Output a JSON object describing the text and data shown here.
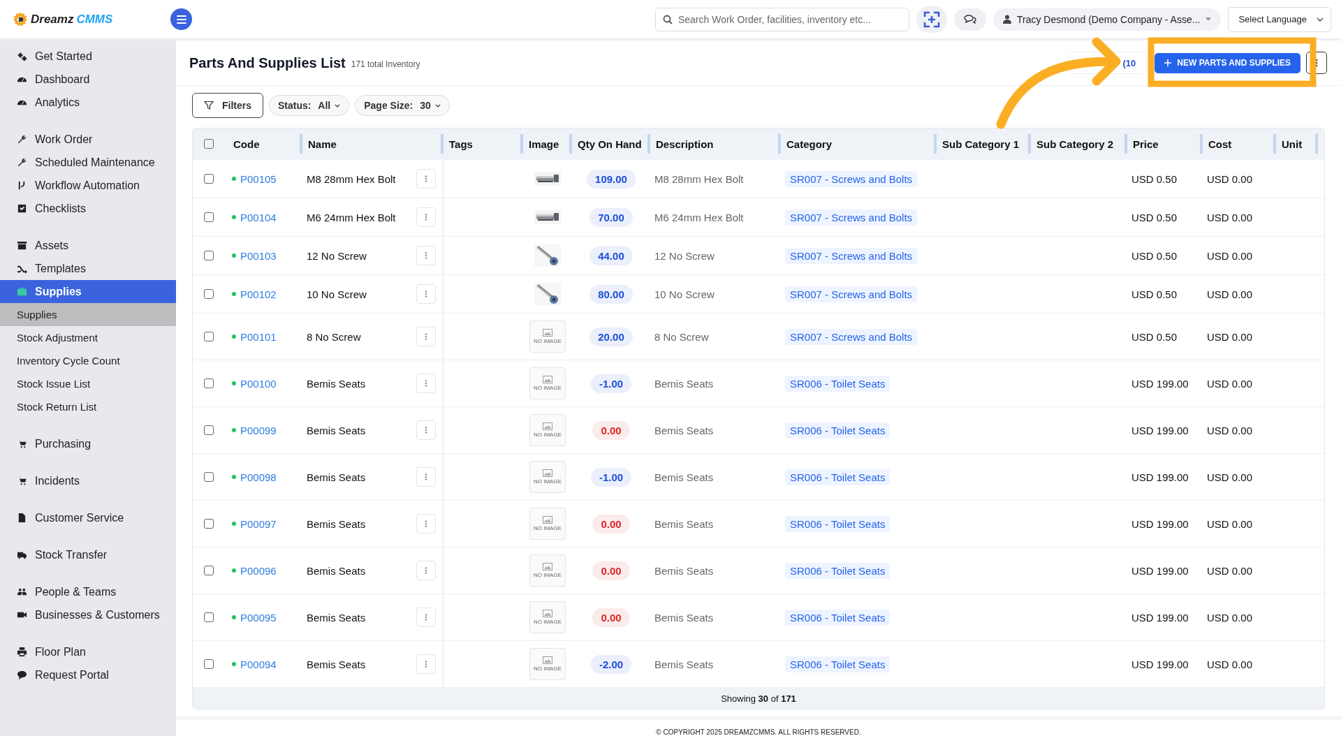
{
  "topbar": {
    "logo": {
      "word": "Dreamz",
      "accent": "CMMS"
    },
    "search": {
      "placeholder": "Search Work Order, facilities, inventory etc..."
    },
    "user": "Tracy Desmond (Demo Company - Asse...",
    "language": "Select Language"
  },
  "sidebar": {
    "sections": [
      {
        "items": [
          {
            "label": "Get Started",
            "selected": false
          },
          {
            "label": "Dashboard",
            "selected": false
          },
          {
            "label": "Analytics",
            "selected": false
          }
        ]
      },
      {
        "items": [
          {
            "label": "Work Order",
            "selected": false
          },
          {
            "label": "Scheduled Maintenance",
            "selected": false
          },
          {
            "label": "Workflow Automation",
            "selected": false
          },
          {
            "label": "Checklists",
            "selected": false
          }
        ]
      },
      {
        "items": [
          {
            "label": "Assets",
            "selected": false
          },
          {
            "label": "Templates",
            "selected": false
          },
          {
            "label": "Supplies",
            "selected": true,
            "expanded": true,
            "children": [
              {
                "label": "Supplies",
                "selected": true
              },
              {
                "label": "Stock Adjustment",
                "selected": false
              },
              {
                "label": "Inventory Cycle Count",
                "selected": false
              },
              {
                "label": "Stock Issue List",
                "selected": false
              },
              {
                "label": "Stock Return List",
                "selected": false
              }
            ]
          }
        ]
      },
      {
        "items": [
          {
            "label": "Purchasing",
            "selected": false
          }
        ]
      },
      {
        "items": [
          {
            "label": "Incidents",
            "selected": false
          }
        ]
      },
      {
        "items": [
          {
            "label": "Customer Service",
            "selected": false
          }
        ]
      },
      {
        "items": [
          {
            "label": "Stock Transfer",
            "selected": false
          }
        ]
      },
      {
        "items": [
          {
            "label": "People & Teams",
            "selected": false
          },
          {
            "label": "Businesses & Customers",
            "selected": false
          }
        ]
      },
      {
        "items": [
          {
            "label": "Floor Plan",
            "selected": false
          },
          {
            "label": "Request Portal",
            "selected": false
          }
        ]
      }
    ]
  },
  "page": {
    "title": "Parts And Supplies List",
    "subtitle": "171 total Inventory",
    "partial_button": "(10",
    "new_button": "NEW PARTS AND SUPPLIES"
  },
  "filters": {
    "button": "Filters",
    "status": {
      "label": "Status:",
      "value": "All"
    },
    "page_size": {
      "label": "Page Size:",
      "value": "30"
    }
  },
  "table": {
    "select_all": {
      "checked": false
    },
    "columns": [
      "Code",
      "Name",
      "Tags",
      "Image",
      "Qty On Hand",
      "Description",
      "Category",
      "Sub Category 1",
      "Sub Category 2",
      "Price",
      "Cost",
      "Unit"
    ],
    "rows": [
      {
        "checked": false,
        "code": "P00105",
        "color": "#22c55e",
        "name": "M8 28mm Hex Bolt",
        "image": {
          "kind": "bolt"
        },
        "qty": {
          "text": "109.00",
          "color": "#1d4ed8"
        },
        "description": "M8 28mm Hex Bolt",
        "category": "SR007 - Screws and Bolts",
        "price": "USD 0.50",
        "cost": "USD 0.00"
      },
      {
        "checked": false,
        "code": "P00104",
        "color": "#22c55e",
        "name": "M6 24mm Hex Bolt",
        "image": {
          "kind": "bolt"
        },
        "qty": {
          "text": "70.00",
          "color": "#1d4ed8"
        },
        "description": "M6 24mm Hex Bolt",
        "category": "SR007 - Screws and Bolts",
        "price": "USD 0.50",
        "cost": "USD 0.00"
      },
      {
        "checked": false,
        "code": "P00103",
        "color": "#22c55e",
        "name": "12 No Screw",
        "image": {
          "kind": "screw"
        },
        "qty": {
          "text": "44.00",
          "color": "#1d4ed8"
        },
        "description": "12 No Screw",
        "category": "SR007 - Screws and Bolts",
        "price": "USD 0.50",
        "cost": "USD 0.00"
      },
      {
        "checked": false,
        "code": "P00102",
        "color": "#22c55e",
        "name": "10 No Screw",
        "image": {
          "kind": "screw"
        },
        "qty": {
          "text": "80.00",
          "color": "#1d4ed8"
        },
        "description": "10 No Screw",
        "category": "SR007 - Screws and Bolts",
        "price": "USD 0.50",
        "cost": "USD 0.00"
      },
      {
        "checked": false,
        "code": "P00101",
        "color": "#22c55e",
        "name": "8 No Screw",
        "image": {
          "kind": "none",
          "text": "NO IMAGE"
        },
        "qty": {
          "text": "20.00",
          "color": "#1d4ed8"
        },
        "description": "8 No Screw",
        "category": "SR007 - Screws and Bolts",
        "price": "USD 0.50",
        "cost": "USD 0.00"
      },
      {
        "checked": false,
        "code": "P00100",
        "color": "#22c55e",
        "name": "Bemis Seats",
        "image": {
          "kind": "none",
          "text": "NO IMAGE"
        },
        "qty": {
          "text": "-1.00",
          "color": "#1d4ed8"
        },
        "description": "Bemis Seats",
        "category": "SR006 - Toilet Seats",
        "price": "USD 199.00",
        "cost": "USD 0.00"
      },
      {
        "checked": false,
        "code": "P00099",
        "color": "#22c55e",
        "name": "Bemis Seats",
        "image": {
          "kind": "none",
          "text": "NO IMAGE"
        },
        "qty": {
          "text": "0.00",
          "color": "#dc2626"
        },
        "description": "Bemis Seats",
        "category": "SR006 - Toilet Seats",
        "price": "USD 199.00",
        "cost": "USD 0.00"
      },
      {
        "checked": false,
        "code": "P00098",
        "color": "#22c55e",
        "name": "Bemis Seats",
        "image": {
          "kind": "none",
          "text": "NO IMAGE"
        },
        "qty": {
          "text": "-1.00",
          "color": "#1d4ed8"
        },
        "description": "Bemis Seats",
        "category": "SR006 - Toilet Seats",
        "price": "USD 199.00",
        "cost": "USD 0.00"
      },
      {
        "checked": false,
        "code": "P00097",
        "color": "#22c55e",
        "name": "Bemis Seats",
        "image": {
          "kind": "none",
          "text": "NO IMAGE"
        },
        "qty": {
          "text": "0.00",
          "color": "#dc2626"
        },
        "description": "Bemis Seats",
        "category": "SR006 - Toilet Seats",
        "price": "USD 199.00",
        "cost": "USD 0.00"
      },
      {
        "checked": false,
        "code": "P00096",
        "color": "#22c55e",
        "name": "Bemis Seats",
        "image": {
          "kind": "none",
          "text": "NO IMAGE"
        },
        "qty": {
          "text": "0.00",
          "color": "#dc2626"
        },
        "description": "Bemis Seats",
        "category": "SR006 - Toilet Seats",
        "price": "USD 199.00",
        "cost": "USD 0.00"
      },
      {
        "checked": false,
        "code": "P00095",
        "color": "#22c55e",
        "name": "Bemis Seats",
        "image": {
          "kind": "none",
          "text": "NO IMAGE"
        },
        "qty": {
          "text": "0.00",
          "color": "#dc2626"
        },
        "description": "Bemis Seats",
        "category": "SR006 - Toilet Seats",
        "price": "USD 199.00",
        "cost": "USD 0.00"
      },
      {
        "checked": false,
        "code": "P00094",
        "color": "#22c55e",
        "name": "Bemis Seats",
        "image": {
          "kind": "none",
          "text": "NO IMAGE"
        },
        "qty": {
          "text": "-2.00",
          "color": "#1d4ed8"
        },
        "description": "Bemis Seats",
        "category": "SR006 - Toilet Seats",
        "price": "USD 199.00",
        "cost": "USD 0.00"
      }
    ],
    "footer": "Showing **30** of **171**"
  },
  "copyright": "© COPYRIGHT 2025 DREAMZCMMS. ALL RIGHTS RESERVED."
}
